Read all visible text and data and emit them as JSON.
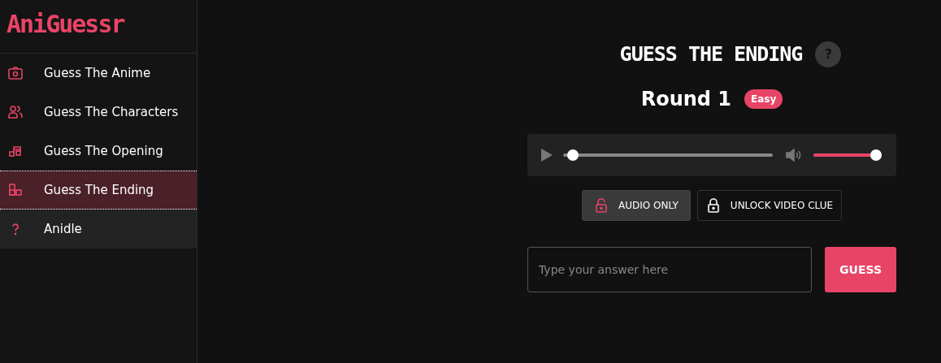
{
  "logo": "AniGuessr",
  "sidebar": {
    "items": [
      {
        "label": "Guess The Anime",
        "selected": false,
        "hovered": false
      },
      {
        "label": "Guess The Characters",
        "selected": false,
        "hovered": false
      },
      {
        "label": "Guess The Opening",
        "selected": false,
        "hovered": false
      },
      {
        "label": "Guess The Ending",
        "selected": true,
        "hovered": false
      },
      {
        "label": "Anidle",
        "selected": false,
        "hovered": true
      }
    ]
  },
  "title": "GUESS THE ENDING",
  "help": "?",
  "round": {
    "label": "Round 1",
    "difficulty": "Easy"
  },
  "player": {
    "progress": {
      "level": 0.02
    },
    "volume": {
      "level": 1
    }
  },
  "modes": [
    {
      "label": "AUDIO ONLY",
      "locked": false,
      "selected": true
    },
    {
      "label": "UNLOCK VIDEO CLUE",
      "locked": true,
      "selected": false
    }
  ],
  "answer": {
    "placeholder": "Type your answer here"
  },
  "guess_button": "GUESS"
}
